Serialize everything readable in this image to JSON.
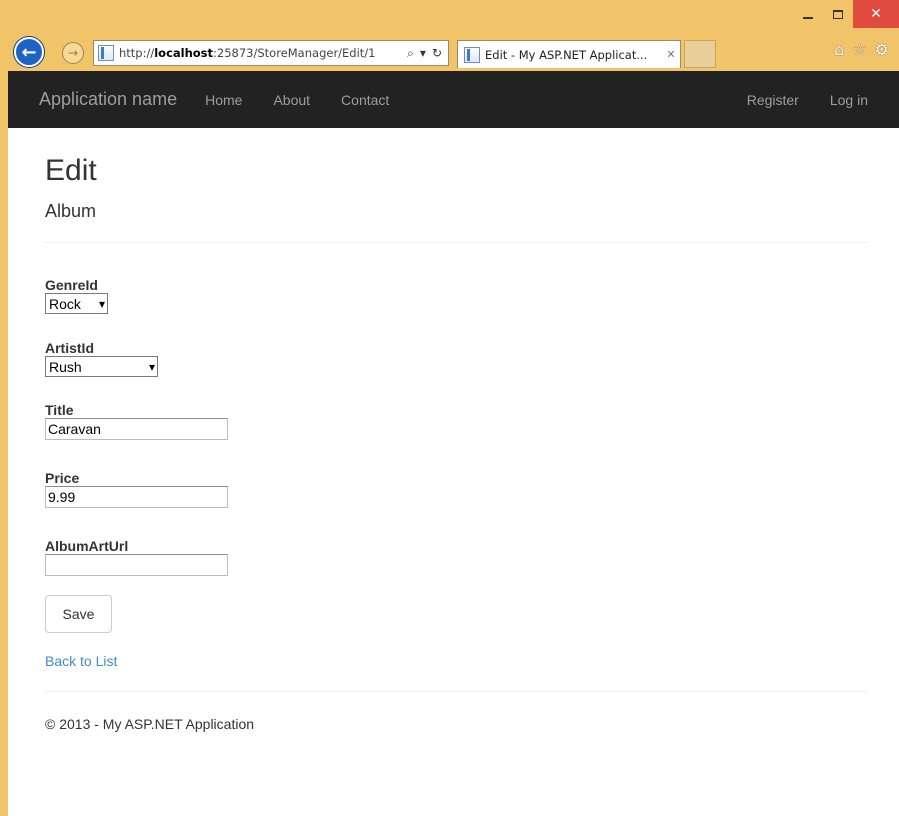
{
  "browser": {
    "url_prefix": "http://",
    "url_host": "localhost",
    "url_rest": ":25873/StoreManager/Edit/1",
    "tab_title": "Edit - My ASP.NET Applicat...",
    "back_icon": "back-arrow-icon",
    "forward_icon": "forward-arrow-icon",
    "home_icon": "home-icon",
    "favorites_icon": "star-icon",
    "settings_icon": "gear-icon"
  },
  "navbar": {
    "brand": "Application name",
    "links": [
      "Home",
      "About",
      "Contact"
    ],
    "right_links": [
      "Register",
      "Log in"
    ]
  },
  "page": {
    "title": "Edit",
    "subtitle": "Album"
  },
  "form": {
    "genre": {
      "label": "GenreId",
      "value": "Rock"
    },
    "artist": {
      "label": "ArtistId",
      "value": "Rush"
    },
    "title": {
      "label": "Title",
      "value": "Caravan"
    },
    "price": {
      "label": "Price",
      "value": "9.99"
    },
    "art_url": {
      "label": "AlbumArtUrl",
      "value": ""
    },
    "save_label": "Save"
  },
  "back_link": "Back to List",
  "footer": "© 2013 - My ASP.NET Application",
  "colors": {
    "frame": "#f1c46a",
    "navbar": "#222222",
    "link": "#428bca",
    "close": "#e04a3f"
  }
}
